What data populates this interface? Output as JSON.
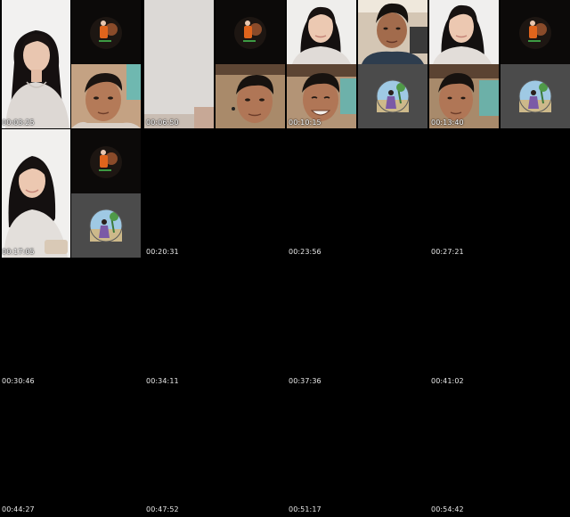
{
  "grid": {
    "timestamps": [
      "00:03:25",
      "00:06:50",
      "00:10:15",
      "00:13:40",
      "00:17:05",
      "00:20:31",
      "00:23:56",
      "00:27:21",
      "00:30:46",
      "00:34:11",
      "00:37:36",
      "00:41:02",
      "00:44:27",
      "00:47:52",
      "00:51:17",
      "00:54:42"
    ]
  },
  "colors": {
    "background": "#000000",
    "timestamp_text": "#e8e8e8",
    "call_placeholder": "#4a4a4a"
  },
  "icons": [
    "avatar-orange-figure-icon",
    "avatar-beach-woman-icon"
  ]
}
